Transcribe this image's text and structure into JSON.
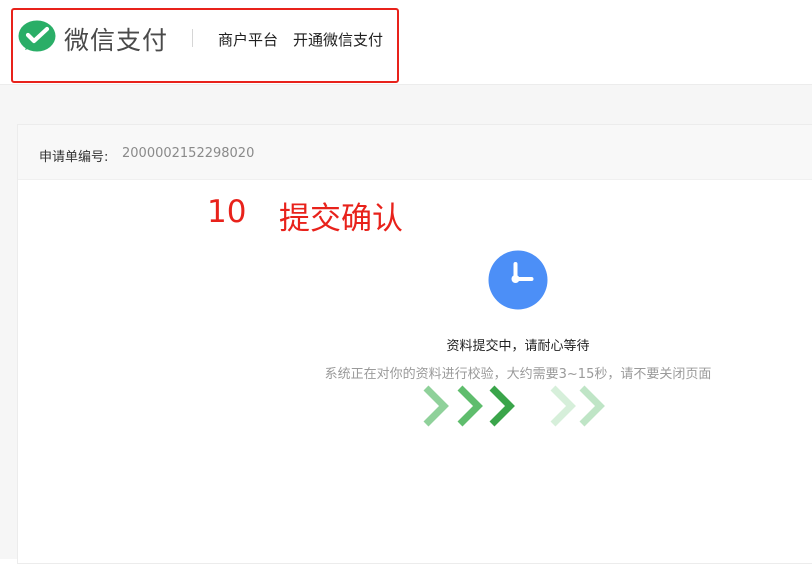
{
  "header": {
    "brand": "微信支付",
    "nav": {
      "merchant_platform": "商户平台",
      "open_wechat_pay": "开通微信支付"
    }
  },
  "application": {
    "order_label": "申请单编号:",
    "order_number": "2000002152298020"
  },
  "annotation": {
    "step_number": "10",
    "step_title": "提交确认"
  },
  "status": {
    "icon": "clock-icon",
    "title": "资料提交中，请耐心等待",
    "description": "系统正在对你的资料进行校验，大约需要3~15秒，请不要关闭页面"
  },
  "colors": {
    "wechat_green": "#2aae67",
    "annotation_red": "#e8221b",
    "clock_blue": "#4c8ff7"
  }
}
